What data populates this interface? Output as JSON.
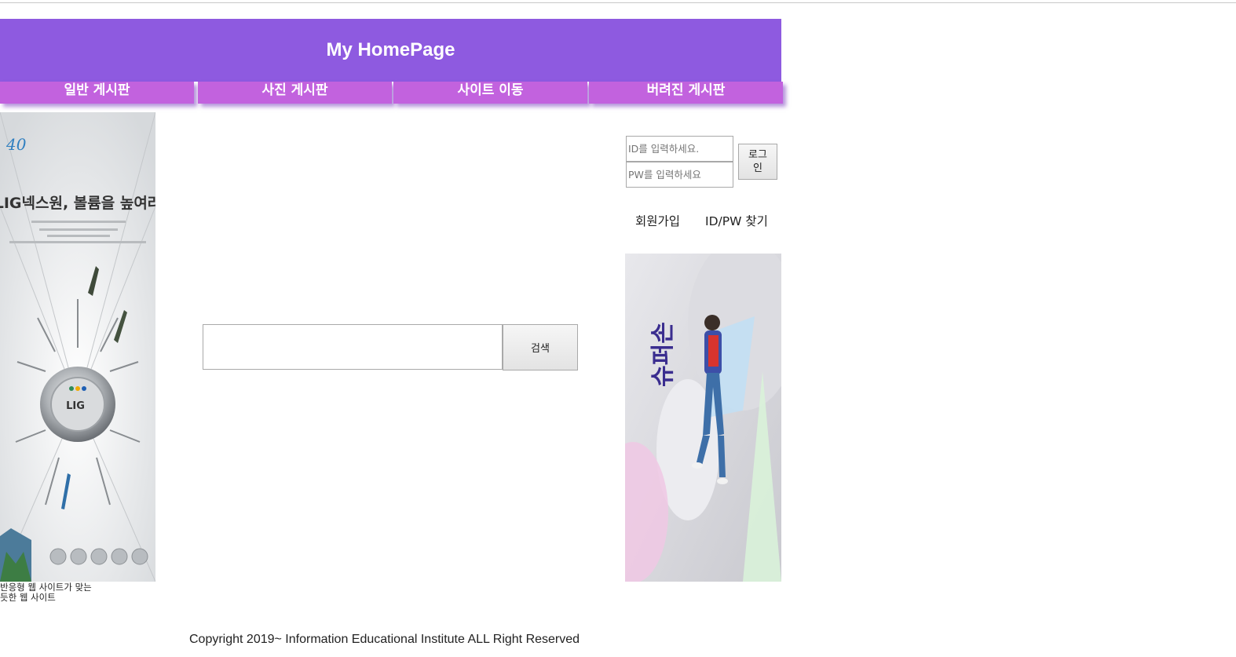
{
  "header": {
    "title": "My HomePage"
  },
  "nav": {
    "items": [
      {
        "label": "일반 게시판"
      },
      {
        "label": "사진 게시판"
      },
      {
        "label": "사이트 이동"
      },
      {
        "label": "버려진 게시판"
      }
    ]
  },
  "left_ad": {
    "headline": "LIG넥스원, 볼륨을 높여라",
    "logo_text": "LIG",
    "caption": "반응형 웹 사이트가 맞는 듯한 웹 사이트"
  },
  "search": {
    "placeholder": "",
    "button_label": "검색"
  },
  "login": {
    "id_placeholder": "ID를 입력하세요.",
    "pw_placeholder": "PW를 입력하세요",
    "button_label": "로그인",
    "signup_label": "회원가입",
    "find_label": "ID/PW 찾기"
  },
  "right_ad": {
    "banner_text": "슈퍼손"
  },
  "footer": {
    "copyright": "Copyright 2019~ Information Educational Institute ALL Right Reserved"
  },
  "colors": {
    "header": "#8e5ae0",
    "nav": "#c262de"
  }
}
